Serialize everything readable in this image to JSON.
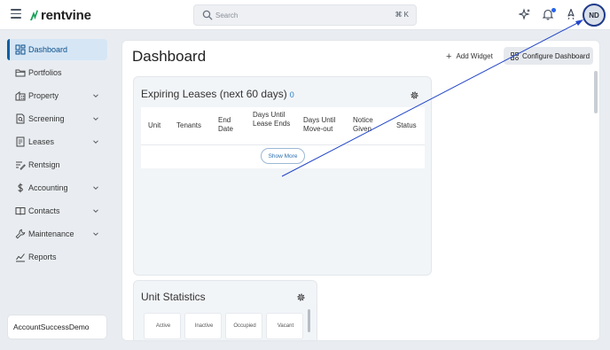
{
  "header": {
    "brand": "rentvine",
    "search_placeholder": "Search",
    "search_shortcut": "⌘ K",
    "avatar_initials": "ND"
  },
  "sidebar": {
    "items": [
      {
        "label": "Dashboard",
        "icon": "dashboard-icon",
        "active": true,
        "expandable": false
      },
      {
        "label": "Portfolios",
        "icon": "folder-icon",
        "active": false,
        "expandable": false
      },
      {
        "label": "Property",
        "icon": "building-icon",
        "active": false,
        "expandable": true
      },
      {
        "label": "Screening",
        "icon": "screening-icon",
        "active": false,
        "expandable": true
      },
      {
        "label": "Leases",
        "icon": "lease-icon",
        "active": false,
        "expandable": true
      },
      {
        "label": "Rentsign",
        "icon": "sign-icon",
        "active": false,
        "expandable": false
      },
      {
        "label": "Accounting",
        "icon": "dollar-icon",
        "active": false,
        "expandable": true
      },
      {
        "label": "Contacts",
        "icon": "book-icon",
        "active": false,
        "expandable": true
      },
      {
        "label": "Maintenance",
        "icon": "wrench-icon",
        "active": false,
        "expandable": true
      },
      {
        "label": "Reports",
        "icon": "chart-icon",
        "active": false,
        "expandable": false
      }
    ],
    "account_name": "AccountSuccessDemo"
  },
  "main": {
    "title": "Dashboard",
    "add_widget_label": "Add Widget",
    "configure_label": "Configure Dashboard",
    "leases_widget": {
      "title": "Expiring Leases (next 60 days)",
      "count": "0",
      "columns": [
        "Unit",
        "Tenants",
        "End Date",
        "Days Until Lease Ends",
        "Days Until Move-out",
        "Notice Given",
        "Status"
      ],
      "show_more_label": "Show More"
    },
    "units_widget": {
      "title": "Unit Statistics",
      "stats": [
        "Active",
        "Inactive",
        "Occupied",
        "Vacant"
      ]
    }
  },
  "colors": {
    "accent": "#0b5fa5",
    "active_bg": "#d6e6f5",
    "link": "#2a7fc9",
    "annotation_arrow": "#2246c8"
  }
}
